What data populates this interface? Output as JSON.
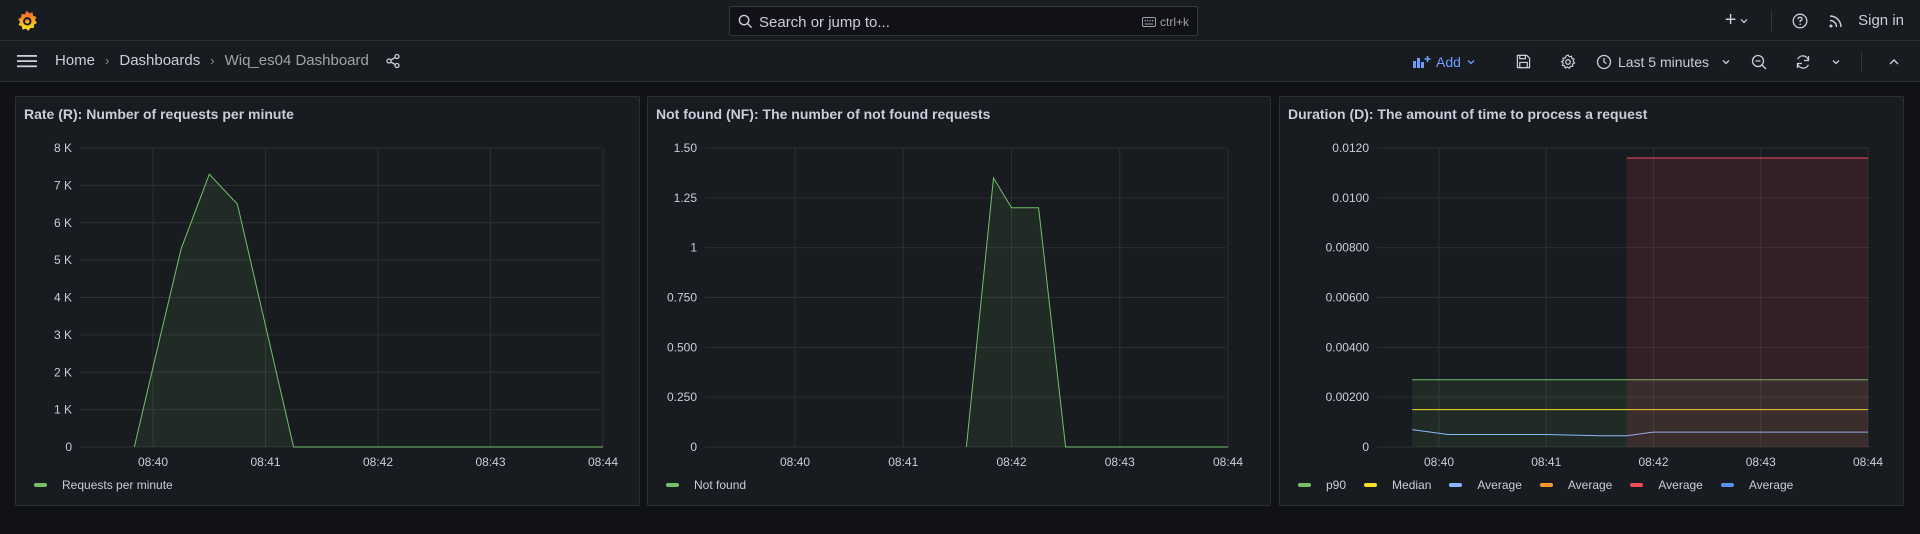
{
  "topbar": {
    "search_placeholder": "Search or jump to...",
    "search_shortcut": "ctrl+k",
    "signin_label": "Sign in",
    "icons": [
      "grafana-logo",
      "search-icon",
      "keyboard-icon",
      "plus-icon",
      "chevron-down-icon",
      "help-icon",
      "rss-icon"
    ]
  },
  "navbar": {
    "breadcrumbs": [
      "Home",
      "Dashboards",
      "Wiq_es04 Dashboard"
    ],
    "add_label": "Add",
    "time_range": "Last 5 minutes",
    "icons": [
      "menu-icon",
      "share-icon",
      "save-icon",
      "settings-icon",
      "clock-icon",
      "zoom-out-icon",
      "refresh-icon",
      "collapse-icon"
    ]
  },
  "colors": {
    "green": "#73bf69",
    "yellow": "#fade2a",
    "cyan": "#8ab8ff",
    "orange": "#ff9830",
    "red": "#f2495c",
    "blue": "#5794f2",
    "accent": "#6e9fff"
  },
  "panels": [
    {
      "title": "Rate (R): Number of requests per minute"
    },
    {
      "title": "Not found (NF): The number of not found requests"
    },
    {
      "title": "Duration (D): The amount of time to process a request"
    }
  ],
  "chart_data": [
    {
      "type": "area",
      "title": "Rate (R): Number of requests per minute",
      "x_ticks": [
        "08:40",
        "08:41",
        "08:42",
        "08:43",
        "08:44"
      ],
      "y_ticks": [
        "0",
        "1 K",
        "2 K",
        "3 K",
        "4 K",
        "5 K",
        "6 K",
        "7 K",
        "8 K"
      ],
      "ylim": [
        0,
        8000
      ],
      "xlim": [
        "08:39:35",
        "08:44:00"
      ],
      "grid": true,
      "legend_position": "bottom-left",
      "series": [
        {
          "name": "Requests per minute",
          "color": "#73bf69",
          "x": [
            "08:39:50",
            "08:40:05",
            "08:40:15",
            "08:40:30",
            "08:40:45",
            "08:41:15",
            "08:44:00"
          ],
          "y": [
            0,
            3200,
            5300,
            7300,
            6500,
            0,
            0
          ]
        }
      ]
    },
    {
      "type": "area",
      "title": "Not found (NF): The number of not found requests",
      "x_ticks": [
        "08:40",
        "08:41",
        "08:42",
        "08:43",
        "08:44"
      ],
      "y_ticks": [
        "0",
        "0.250",
        "0.500",
        "0.750",
        "1",
        "1.25",
        "1.50"
      ],
      "ylim": [
        0,
        1.5
      ],
      "xlim": [
        "08:39:25",
        "08:44:00"
      ],
      "grid": true,
      "legend_position": "bottom-left",
      "series": [
        {
          "name": "Not found",
          "color": "#73bf69",
          "x": [
            "08:41:35",
            "08:41:50",
            "08:42:00",
            "08:42:15",
            "08:42:30",
            "08:44:00"
          ],
          "y": [
            0,
            1.35,
            1.2,
            1.2,
            0,
            0
          ]
        }
      ]
    },
    {
      "type": "line",
      "title": "Duration (D): The amount of time to process a request",
      "x_ticks": [
        "08:40",
        "08:41",
        "08:42",
        "08:43",
        "08:44"
      ],
      "y_ticks": [
        "0",
        "0.00200",
        "0.00400",
        "0.00600",
        "0.00800",
        "0.0100",
        "0.0120"
      ],
      "ylim": [
        0,
        0.012
      ],
      "xlim": [
        "08:39:05",
        "08:44:00"
      ],
      "grid": true,
      "legend_position": "bottom-left",
      "series": [
        {
          "name": "p90",
          "color": "#73bf69",
          "x": [
            "08:39:45",
            "08:44:00"
          ],
          "y": [
            0.0027,
            0.0027
          ],
          "fill": true
        },
        {
          "name": "Median",
          "color": "#fade2a",
          "x": [
            "08:39:45",
            "08:44:00"
          ],
          "y": [
            0.0015,
            0.0015
          ],
          "fill": false
        },
        {
          "name": "Average",
          "color": "#8ab8ff",
          "x": [
            "08:39:45",
            "08:40:05",
            "08:40:30",
            "08:41:00",
            "08:41:30",
            "08:41:45",
            "08:42:00",
            "08:42:30",
            "08:43:00",
            "08:44:00"
          ],
          "y": [
            0.0007,
            0.0005,
            0.0005,
            0.0005,
            0.00045,
            0.00045,
            0.0006,
            0.0006,
            0.0006,
            0.0006
          ],
          "fill": false
        },
        {
          "name": "Average",
          "color": "#ff9830",
          "x": [],
          "y": [],
          "fill": false
        },
        {
          "name": "Average",
          "color": "#f2495c",
          "x": [
            "08:41:45",
            "08:44:00"
          ],
          "y": [
            0.0116,
            0.0116
          ],
          "fill": true
        },
        {
          "name": "Average",
          "color": "#5794f2",
          "x": [],
          "y": [],
          "fill": false
        }
      ]
    }
  ]
}
